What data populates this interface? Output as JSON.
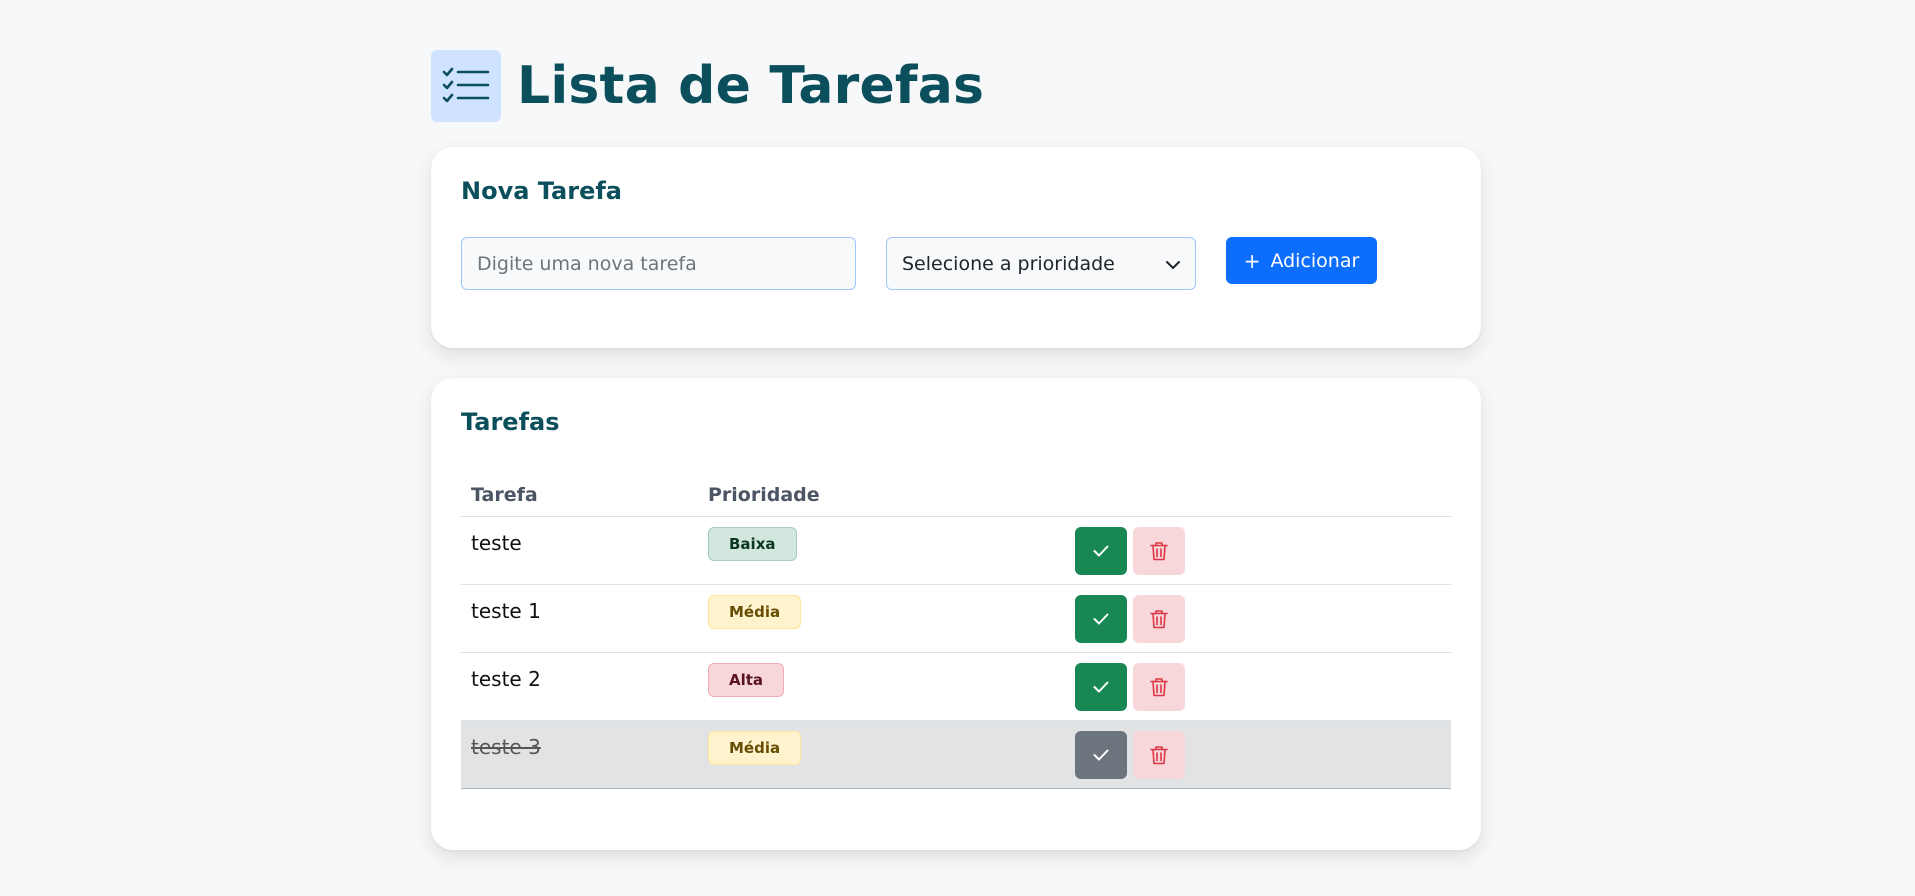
{
  "header": {
    "title": "Lista de Tarefas",
    "logo_icon": "checklist-icon",
    "logo_bg": "#cfe2ff",
    "title_color": "#0b4f5c"
  },
  "new_task": {
    "title": "Nova Tarefa",
    "input_placeholder": "Digite uma nova tarefa",
    "input_value": "",
    "priority_select": {
      "selected": "Selecione a prioridade"
    },
    "add_button": {
      "label": "Adicionar",
      "icon": "plus-icon",
      "color": "#0d6efd"
    }
  },
  "task_list": {
    "title": "Tarefas",
    "columns": [
      "Tarefa",
      "Prioridade"
    ],
    "rows": [
      {
        "task": "teste",
        "priority": "Baixa",
        "priority_level": "low",
        "done": false
      },
      {
        "task": "teste 1",
        "priority": "Média",
        "priority_level": "med",
        "done": false
      },
      {
        "task": "teste 2",
        "priority": "Alta",
        "priority_level": "high",
        "done": false
      },
      {
        "task": "teste 3",
        "priority": "Média",
        "priority_level": "med",
        "done": true
      }
    ],
    "action_icons": {
      "complete": "check-icon",
      "delete": "trash-icon"
    },
    "colors": {
      "complete": "#198754",
      "complete_done": "#6c757d",
      "delete_bg": "#f8d7da",
      "delete_icon": "#dc3545"
    }
  }
}
